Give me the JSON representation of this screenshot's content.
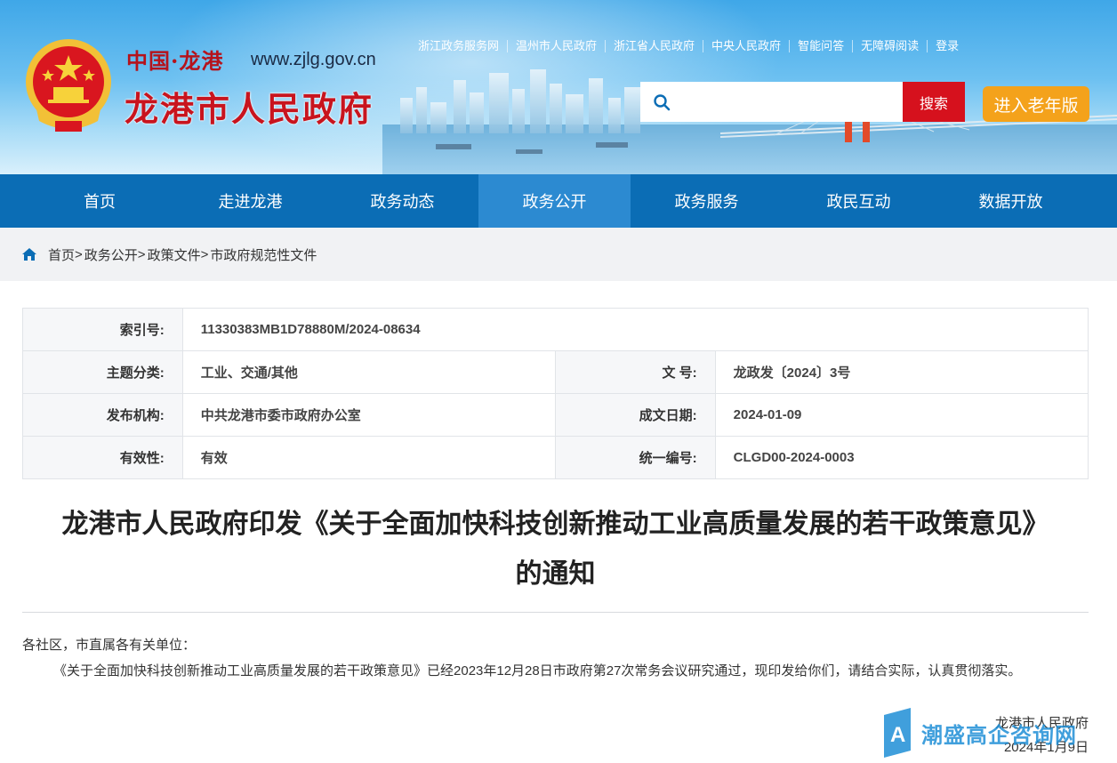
{
  "header": {
    "sub_title": "中国·龙港",
    "url": "www.zjlg.gov.cn",
    "site_name": "龙港市人民政府",
    "top_links": [
      "浙江政务服务网",
      "温州市人民政府",
      "浙江省人民政府",
      "中央人民政府",
      "智能问答",
      "无障碍阅读",
      "登录"
    ],
    "search_placeholder": "",
    "search_button": "搜索",
    "elder_button": "进入老年版"
  },
  "nav": {
    "items": [
      "首页",
      "走进龙港",
      "政务动态",
      "政务公开",
      "政务服务",
      "政民互动",
      "数据开放"
    ],
    "active_index": 3
  },
  "breadcrumb": [
    "首页",
    "政务公开",
    "政策文件",
    "市政府规范性文件"
  ],
  "info": {
    "index_label": "索引号:",
    "index_value": "11330383MB1D78880M/2024-08634",
    "topic_label": "主题分类:",
    "topic_value": "工业、交通/其他",
    "docno_label": "文      号:",
    "docno_value": "龙政发〔2024〕3号",
    "org_label": "发布机构:",
    "org_value": "中共龙港市委市政府办公室",
    "date_label": "成文日期:",
    "date_value": "2024-01-09",
    "valid_label": "有效性:",
    "valid_value": "有效",
    "unified_label": "统一编号:",
    "unified_value": "CLGD00-2024-0003"
  },
  "document": {
    "title_line1": "龙港市人民政府印发《关于全面加快科技创新推动工业高质量发展的若干政策意见》",
    "title_line2": "的通知",
    "addressee": "各社区，市直属各有关单位：",
    "body": "《关于全面加快科技创新推动工业高质量发展的若干政策意见》已经2023年12月28日市政府第27次常务会议研究通过，现印发给你们，请结合实际，认真贯彻落实。",
    "sign_org": "龙港市人民政府",
    "sign_date": "2024年1月9日"
  },
  "watermark": {
    "text": "潮盛高企咨询网"
  },
  "colors": {
    "nav_bg": "#0b6db5",
    "nav_active": "#2c8ad1",
    "brand_red": "#c8141e",
    "elder_orange": "#f4a21b"
  }
}
